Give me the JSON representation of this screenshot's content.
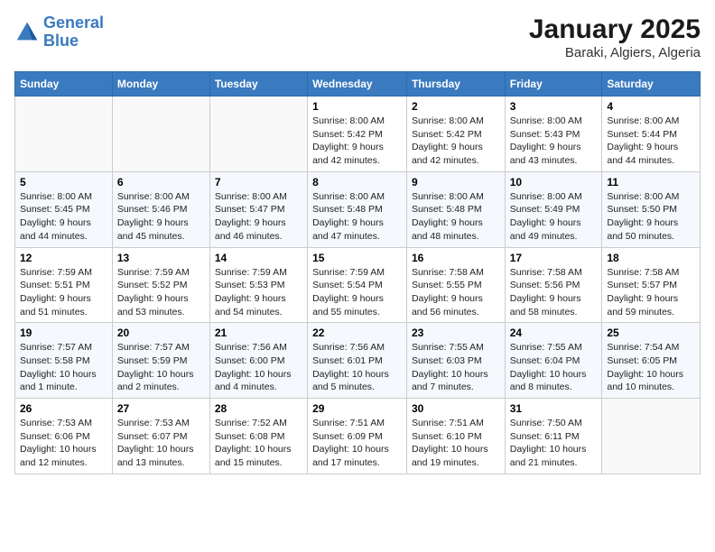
{
  "header": {
    "logo_line1": "General",
    "logo_line2": "Blue",
    "title": "January 2025",
    "subtitle": "Baraki, Algiers, Algeria"
  },
  "weekdays": [
    "Sunday",
    "Monday",
    "Tuesday",
    "Wednesday",
    "Thursday",
    "Friday",
    "Saturday"
  ],
  "weeks": [
    [
      {
        "day": "",
        "info": ""
      },
      {
        "day": "",
        "info": ""
      },
      {
        "day": "",
        "info": ""
      },
      {
        "day": "1",
        "info": "Sunrise: 8:00 AM\nSunset: 5:42 PM\nDaylight: 9 hours\nand 42 minutes."
      },
      {
        "day": "2",
        "info": "Sunrise: 8:00 AM\nSunset: 5:42 PM\nDaylight: 9 hours\nand 42 minutes."
      },
      {
        "day": "3",
        "info": "Sunrise: 8:00 AM\nSunset: 5:43 PM\nDaylight: 9 hours\nand 43 minutes."
      },
      {
        "day": "4",
        "info": "Sunrise: 8:00 AM\nSunset: 5:44 PM\nDaylight: 9 hours\nand 44 minutes."
      }
    ],
    [
      {
        "day": "5",
        "info": "Sunrise: 8:00 AM\nSunset: 5:45 PM\nDaylight: 9 hours\nand 44 minutes."
      },
      {
        "day": "6",
        "info": "Sunrise: 8:00 AM\nSunset: 5:46 PM\nDaylight: 9 hours\nand 45 minutes."
      },
      {
        "day": "7",
        "info": "Sunrise: 8:00 AM\nSunset: 5:47 PM\nDaylight: 9 hours\nand 46 minutes."
      },
      {
        "day": "8",
        "info": "Sunrise: 8:00 AM\nSunset: 5:48 PM\nDaylight: 9 hours\nand 47 minutes."
      },
      {
        "day": "9",
        "info": "Sunrise: 8:00 AM\nSunset: 5:48 PM\nDaylight: 9 hours\nand 48 minutes."
      },
      {
        "day": "10",
        "info": "Sunrise: 8:00 AM\nSunset: 5:49 PM\nDaylight: 9 hours\nand 49 minutes."
      },
      {
        "day": "11",
        "info": "Sunrise: 8:00 AM\nSunset: 5:50 PM\nDaylight: 9 hours\nand 50 minutes."
      }
    ],
    [
      {
        "day": "12",
        "info": "Sunrise: 7:59 AM\nSunset: 5:51 PM\nDaylight: 9 hours\nand 51 minutes."
      },
      {
        "day": "13",
        "info": "Sunrise: 7:59 AM\nSunset: 5:52 PM\nDaylight: 9 hours\nand 53 minutes."
      },
      {
        "day": "14",
        "info": "Sunrise: 7:59 AM\nSunset: 5:53 PM\nDaylight: 9 hours\nand 54 minutes."
      },
      {
        "day": "15",
        "info": "Sunrise: 7:59 AM\nSunset: 5:54 PM\nDaylight: 9 hours\nand 55 minutes."
      },
      {
        "day": "16",
        "info": "Sunrise: 7:58 AM\nSunset: 5:55 PM\nDaylight: 9 hours\nand 56 minutes."
      },
      {
        "day": "17",
        "info": "Sunrise: 7:58 AM\nSunset: 5:56 PM\nDaylight: 9 hours\nand 58 minutes."
      },
      {
        "day": "18",
        "info": "Sunrise: 7:58 AM\nSunset: 5:57 PM\nDaylight: 9 hours\nand 59 minutes."
      }
    ],
    [
      {
        "day": "19",
        "info": "Sunrise: 7:57 AM\nSunset: 5:58 PM\nDaylight: 10 hours\nand 1 minute."
      },
      {
        "day": "20",
        "info": "Sunrise: 7:57 AM\nSunset: 5:59 PM\nDaylight: 10 hours\nand 2 minutes."
      },
      {
        "day": "21",
        "info": "Sunrise: 7:56 AM\nSunset: 6:00 PM\nDaylight: 10 hours\nand 4 minutes."
      },
      {
        "day": "22",
        "info": "Sunrise: 7:56 AM\nSunset: 6:01 PM\nDaylight: 10 hours\nand 5 minutes."
      },
      {
        "day": "23",
        "info": "Sunrise: 7:55 AM\nSunset: 6:03 PM\nDaylight: 10 hours\nand 7 minutes."
      },
      {
        "day": "24",
        "info": "Sunrise: 7:55 AM\nSunset: 6:04 PM\nDaylight: 10 hours\nand 8 minutes."
      },
      {
        "day": "25",
        "info": "Sunrise: 7:54 AM\nSunset: 6:05 PM\nDaylight: 10 hours\nand 10 minutes."
      }
    ],
    [
      {
        "day": "26",
        "info": "Sunrise: 7:53 AM\nSunset: 6:06 PM\nDaylight: 10 hours\nand 12 minutes."
      },
      {
        "day": "27",
        "info": "Sunrise: 7:53 AM\nSunset: 6:07 PM\nDaylight: 10 hours\nand 13 minutes."
      },
      {
        "day": "28",
        "info": "Sunrise: 7:52 AM\nSunset: 6:08 PM\nDaylight: 10 hours\nand 15 minutes."
      },
      {
        "day": "29",
        "info": "Sunrise: 7:51 AM\nSunset: 6:09 PM\nDaylight: 10 hours\nand 17 minutes."
      },
      {
        "day": "30",
        "info": "Sunrise: 7:51 AM\nSunset: 6:10 PM\nDaylight: 10 hours\nand 19 minutes."
      },
      {
        "day": "31",
        "info": "Sunrise: 7:50 AM\nSunset: 6:11 PM\nDaylight: 10 hours\nand 21 minutes."
      },
      {
        "day": "",
        "info": ""
      }
    ]
  ]
}
